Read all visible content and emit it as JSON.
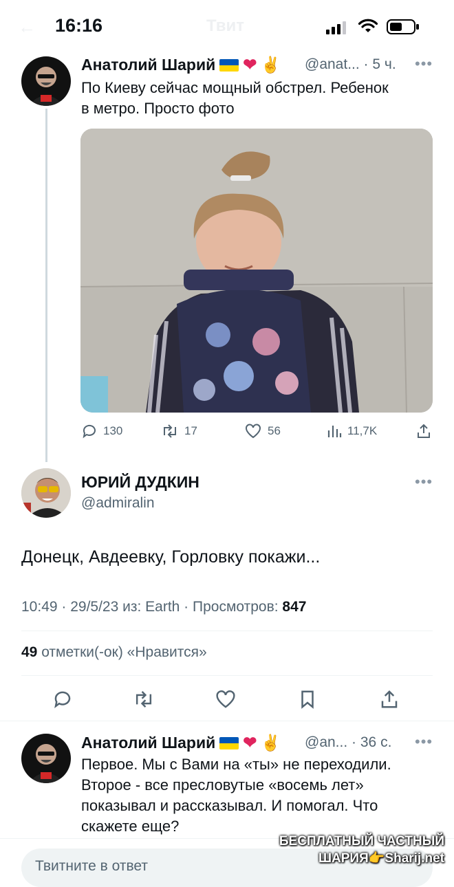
{
  "status_bar": {
    "time": "16:16"
  },
  "header": {
    "back_icon": "arrow-left-icon",
    "title": "Твит"
  },
  "tweet1": {
    "author": "Анатолий Шарий",
    "handle": "@anat...",
    "separator": "·",
    "time": "5 ч.",
    "text_line1": "По Киеву сейчас мощный обстрел. Ребенок",
    "text_line2": "в метро. Просто фото",
    "metrics": {
      "replies": "130",
      "retweets": "17",
      "likes": "56",
      "views": "11,7K"
    }
  },
  "main_tweet": {
    "author": "ЮРИЙ ДУДКИН",
    "handle": "@admiralin",
    "text": "Донецк, Авдеевку, Горловку покажи...",
    "timestamp": "10:49 · 29/5/23 из: Earth · Просмотров:",
    "views": "847",
    "likes_count": "49",
    "likes_label": "отметки(-ок) «Нравится»"
  },
  "tweet3": {
    "author": "Анатолий Шарий",
    "handle": "@an...",
    "separator": "·",
    "time": "36 с.",
    "text_line1": "Первое. Мы с Вами на «ты» не переходили.",
    "text_line2": "Второе - все пресловутые «восемь лет»",
    "text_line3": "показывал и рассказывал. И помогал. Что",
    "text_line4": "скажете еще?"
  },
  "reply_box": {
    "placeholder": "Твитните в ответ"
  },
  "watermark": {
    "line1": "БЕСПЛАТНЫЙ ЧАСТНЫЙ",
    "line2": "ШАРИЯ",
    "line3": "Sharij.net"
  },
  "colors": {
    "accent": "#1d9bf0",
    "text": "#0f1419",
    "muted": "#536471",
    "divider": "#eff3f4",
    "heart": "#e0245e"
  }
}
